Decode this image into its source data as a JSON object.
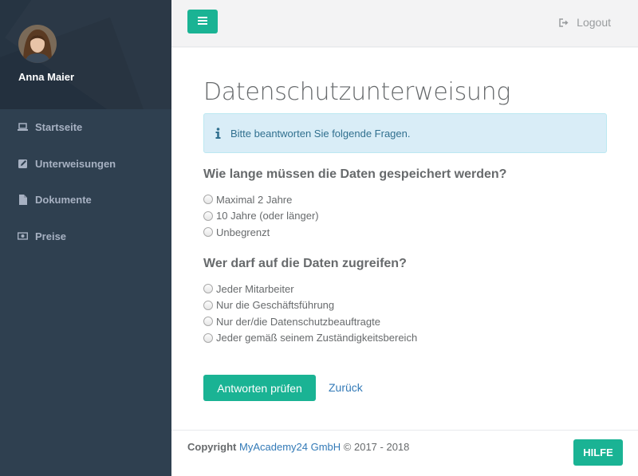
{
  "user": {
    "name": "Anna Maier"
  },
  "sidebar": {
    "items": [
      {
        "label": "Startseite",
        "icon": "laptop-icon"
      },
      {
        "label": "Unterweisungen",
        "icon": "edit-icon"
      },
      {
        "label": "Dokumente",
        "icon": "file-icon"
      },
      {
        "label": "Preise",
        "icon": "money-icon"
      }
    ]
  },
  "topbar": {
    "logout_label": "Logout"
  },
  "page": {
    "title": "Datenschutzunterweisung",
    "alert": "Bitte beantworten Sie folgende Fragen."
  },
  "questions": [
    {
      "title": "Wie lange müssen die Daten gespeichert werden?",
      "options": [
        "Maximal 2 Jahre",
        "10 Jahre (oder länger)",
        "Unbegrenzt"
      ]
    },
    {
      "title": "Wer darf auf die Daten zugreifen?",
      "options": [
        "Jeder Mitarbeiter",
        "Nur die Geschäftsführung",
        "Nur der/die Datenschutzbeauftragte",
        "Jeder gemäß seinem Zuständigkeitsbereich"
      ]
    }
  ],
  "actions": {
    "submit_label": "Antworten prüfen",
    "back_label": "Zurück"
  },
  "footer": {
    "copyright_label": "Copyright",
    "company": "MyAcademy24 GmbH",
    "years": "© 2017 - 2018",
    "help_label": "HILFE"
  },
  "colors": {
    "accent": "#1ab394",
    "sidebar": "#2f4050",
    "link": "#337ab7",
    "alert_bg": "#d9edf7"
  }
}
